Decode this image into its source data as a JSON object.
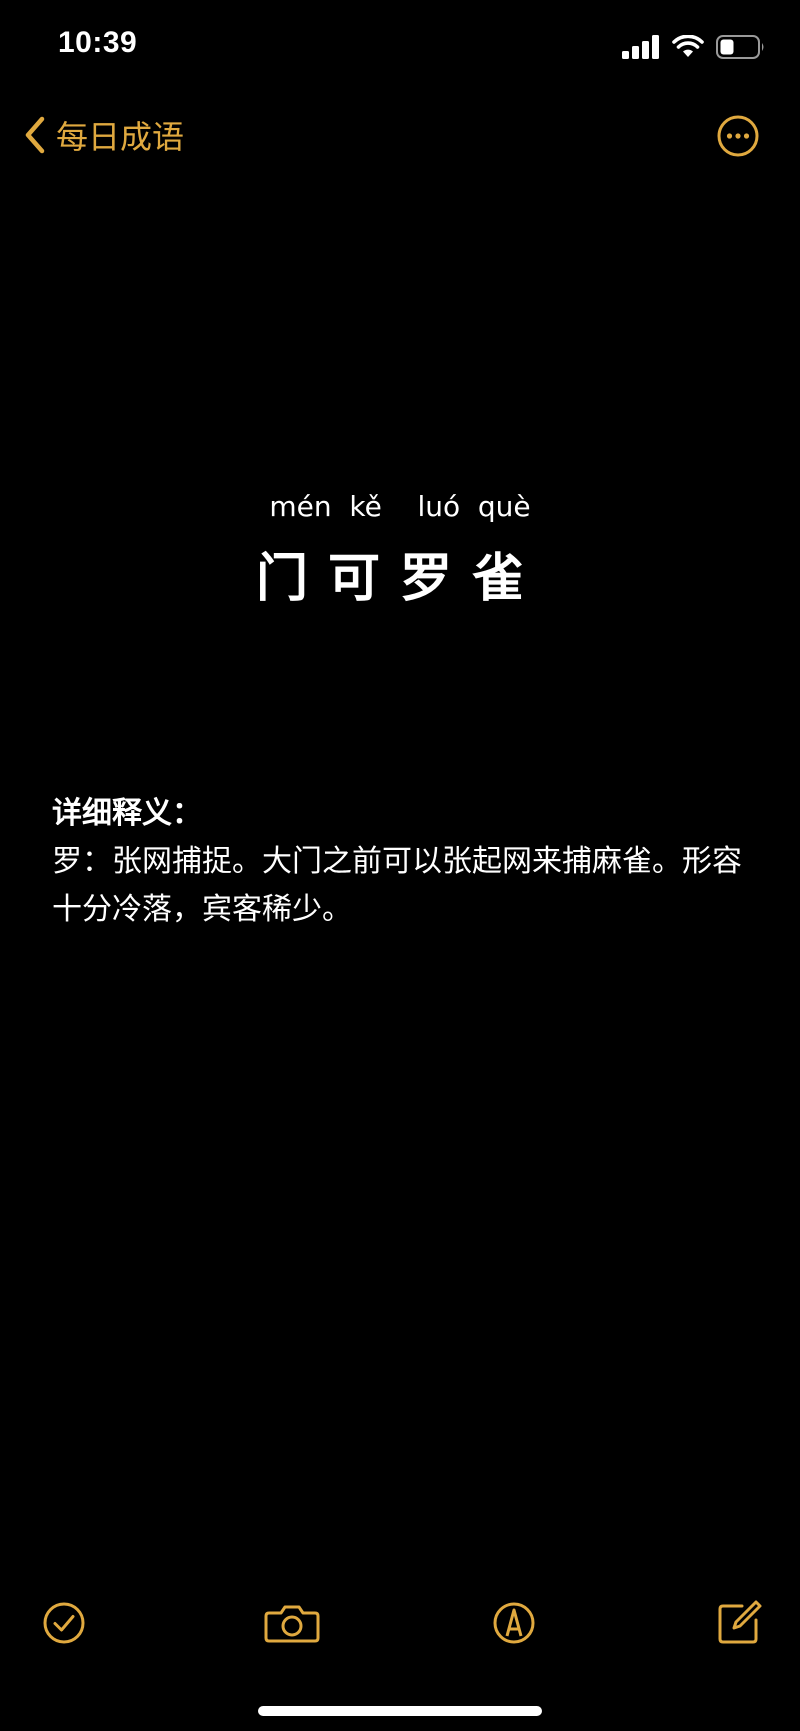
{
  "status_bar": {
    "time": "10:39",
    "icons": [
      "cellular-signal-icon",
      "wifi-icon",
      "battery-icon"
    ]
  },
  "nav": {
    "back_label": "每日成语",
    "back_icon": "chevron-left-icon",
    "more_icon": "more-ellipsis-icon"
  },
  "idiom": {
    "pinyin": "mén  kě    luó  què",
    "characters": "门可罗雀"
  },
  "explanation": {
    "heading": "详细释义：",
    "body": "罗：张网捕捉。大门之前可以张起网来捕麻雀。形容十分冷落，宾客稀少。"
  },
  "toolbar": {
    "items": [
      "checklist-icon",
      "camera-icon",
      "markup-pen-icon",
      "compose-icon"
    ]
  },
  "colors": {
    "accent": "#e0a93f",
    "background": "#000000",
    "text": "#ffffff"
  }
}
